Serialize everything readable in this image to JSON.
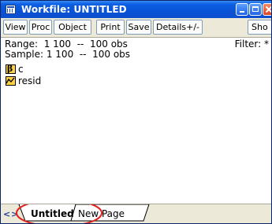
{
  "window": {
    "title": "Workfile: UNTITLED",
    "title_icon": "workfile-icon",
    "controls": [
      "minimize",
      "maximize",
      "close"
    ]
  },
  "toolbar": {
    "view": "View",
    "proc": "Proc",
    "object": "Object",
    "print": "Print",
    "save": "Save",
    "details": "Details+/-",
    "show": "Sho"
  },
  "info": {
    "range": "Range:  1 100  --  100 obs",
    "sample": "Sample: 1 100  --  100 obs",
    "filter": "Filter: *"
  },
  "objects": [
    {
      "name": "c",
      "icon": "coefficient-beta-icon"
    },
    {
      "name": "resid",
      "icon": "series-line-icon"
    }
  ],
  "tabs": {
    "nav_left": "<",
    "nav_right": ">",
    "items": [
      {
        "label": "Untitled",
        "active": true
      },
      {
        "label": "New Page",
        "active": false
      }
    ]
  },
  "colors": {
    "titlebar": "#0a53d6",
    "icon_yellow": "#ffd23f",
    "highlight_ellipse": "#e0201b"
  }
}
